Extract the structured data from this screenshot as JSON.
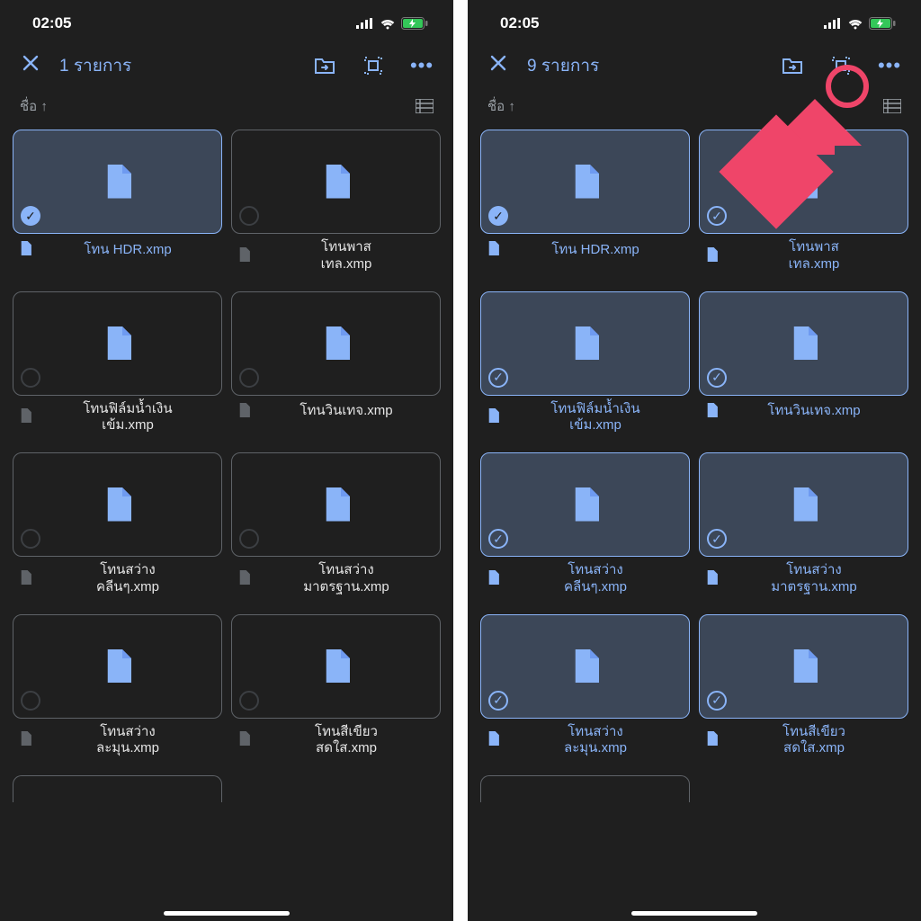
{
  "statusbar": {
    "time": "02:05"
  },
  "left": {
    "selection_label": "1 รายการ",
    "sort_label": "ชื่อ ↑",
    "files": [
      {
        "name": "โทน HDR.xmp",
        "selected": true
      },
      {
        "name": "โทนพาส\nเทล.xmp",
        "selected": false
      },
      {
        "name": "โทนฟิล์มน้ำเงิน\nเข้ม.xmp",
        "selected": false
      },
      {
        "name": "โทนวินเทจ.xmp",
        "selected": false
      },
      {
        "name": "โทนสว่าง\nคลีนๆ.xmp",
        "selected": false
      },
      {
        "name": "โทนสว่าง\nมาตรฐาน.xmp",
        "selected": false
      },
      {
        "name": "โทนสว่าง\nละมุน.xmp",
        "selected": false
      },
      {
        "name": "โทนสีเขียว\nสดใส.xmp",
        "selected": false
      }
    ]
  },
  "right": {
    "selection_label": "9 รายการ",
    "sort_label": "ชื่อ ↑",
    "files": [
      {
        "name": "โทน HDR.xmp",
        "selected": true
      },
      {
        "name": "โทนพาส\nเทล.xmp",
        "selected": true
      },
      {
        "name": "โทนฟิล์มน้ำเงิน\nเข้ม.xmp",
        "selected": true
      },
      {
        "name": "โทนวินเทจ.xmp",
        "selected": true
      },
      {
        "name": "โทนสว่าง\nคลีนๆ.xmp",
        "selected": true
      },
      {
        "name": "โทนสว่าง\nมาตรฐาน.xmp",
        "selected": true
      },
      {
        "name": "โทนสว่าง\nละมุน.xmp",
        "selected": true
      },
      {
        "name": "โทนสีเขียว\nสดใส.xmp",
        "selected": true
      }
    ]
  }
}
